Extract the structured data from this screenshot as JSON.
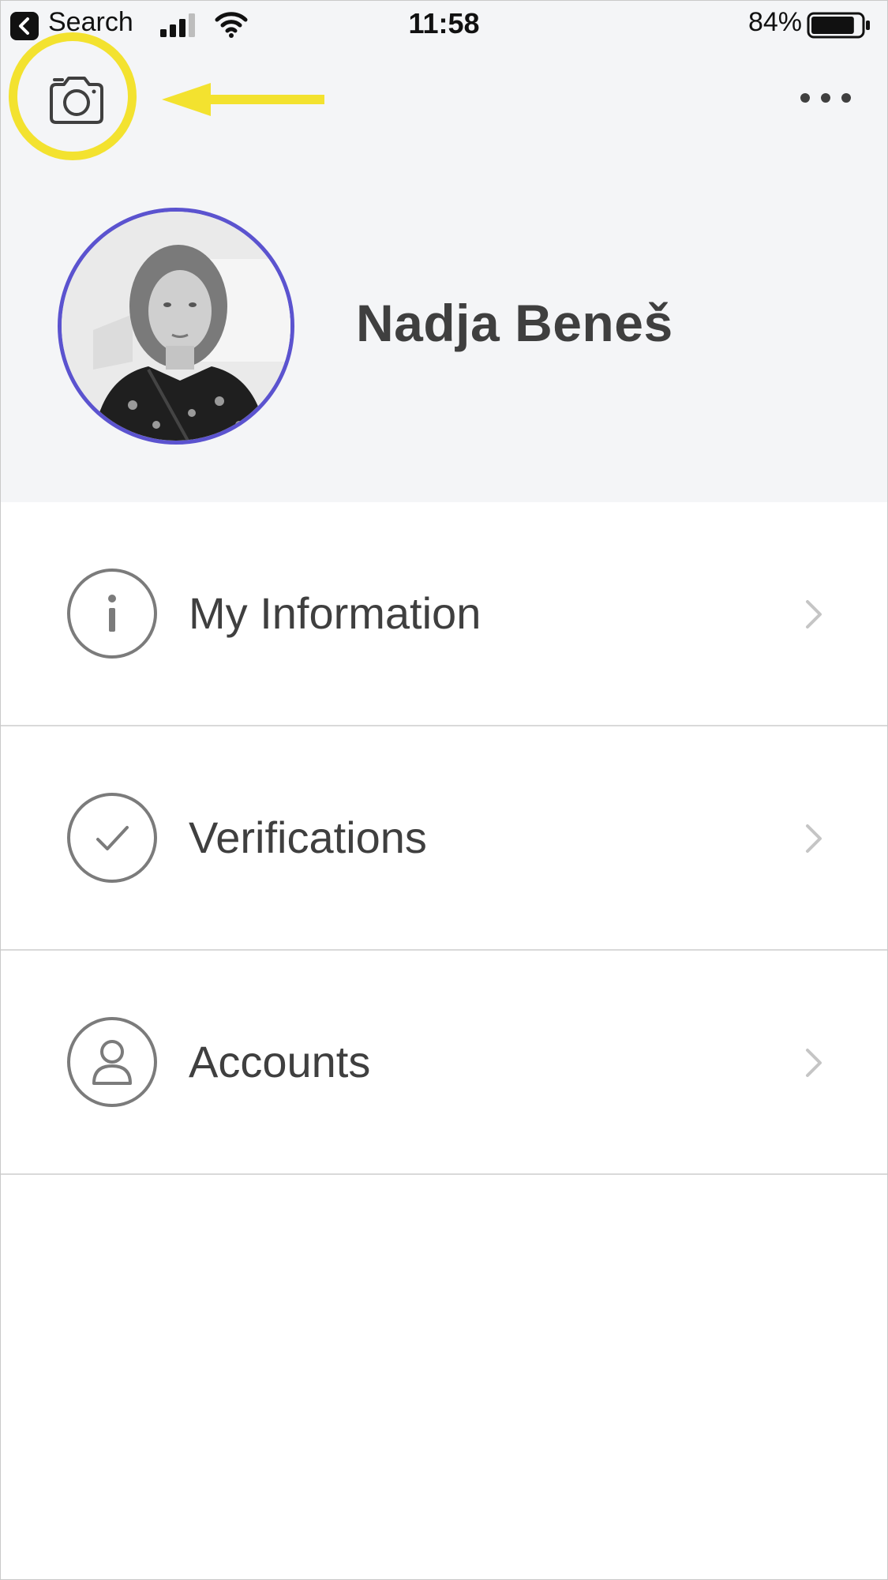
{
  "status_bar": {
    "back_label": "Search",
    "time": "11:58",
    "battery_percent": "84%",
    "battery_level": 0.84
  },
  "header": {
    "camera_icon": "camera-icon",
    "more_icon": "more-horizontal-icon"
  },
  "profile": {
    "name": "Nadja Beneš"
  },
  "menu": {
    "items": [
      {
        "label": "My Information",
        "icon": "info-icon"
      },
      {
        "label": "Verifications",
        "icon": "checkmark-icon"
      },
      {
        "label": "Accounts",
        "icon": "user-icon"
      }
    ]
  },
  "colors": {
    "header_background": "#f4f5f7",
    "avatar_ring": "#5b53cf",
    "highlight": "#f3e22f",
    "text": "#3f3f3f",
    "icon_gray": "#7b7b7b"
  }
}
